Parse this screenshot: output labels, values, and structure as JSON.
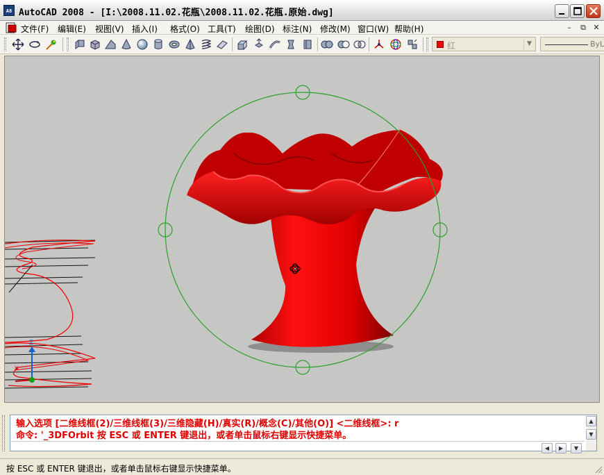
{
  "window": {
    "app_icon_text": "A8",
    "title": "AutoCAD 2008 - [I:\\2008.11.02.花瓶\\2008.11.02.花瓶.原始.dwg]"
  },
  "menu": {
    "items": [
      "文件(F)",
      "编辑(E)",
      "视图(V)",
      "插入(I)",
      "格式(O)",
      "工具(T)",
      "绘图(D)",
      "标注(N)",
      "修改(M)",
      "窗口(W)",
      "帮助(H)"
    ]
  },
  "toolbar": {
    "color_value": "红",
    "linetype_value": "ByL"
  },
  "command": {
    "line1": "输入选项 [二维线框(2)/三维线框(3)/三维隐藏(H)/真实(R)/概念(C)/其他(O)] <二维线框>: r",
    "line2": "命令: '_3DFOrbit 按 ESC 或 ENTER 键退出，或者单击鼠标右键显示快捷菜单。",
    "input": ""
  },
  "status": {
    "text": "按 ESC 或 ENTER 键退出，或者单击鼠标右键显示快捷菜单。"
  },
  "colors": {
    "viewport_bg": "#c6c6c4",
    "vase_red": "#e00000",
    "orbit_green": "#2aa02a",
    "command_text": "#e00000"
  }
}
